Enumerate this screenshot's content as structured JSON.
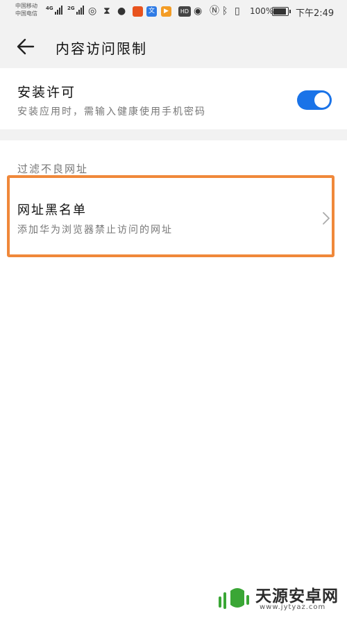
{
  "status_bar": {
    "carrier_1": "中国移动",
    "carrier_2": "中国电信",
    "network_1": "4G",
    "network_2": "2G",
    "hd_badge": "HD",
    "battery_percent": "100%",
    "battery_level": 1.0,
    "time": "下午2:49",
    "app_badge_text": "文"
  },
  "header": {
    "title": "内容访问限制"
  },
  "install_permission": {
    "title": "安装许可",
    "subtitle": "安装应用时，需输入健康使用手机密码",
    "toggle_on": true
  },
  "filter_section": {
    "label": "过滤不良网址",
    "url_blacklist": {
      "title": "网址黑名单",
      "subtitle": "添加华为浏览器禁止访问的网址"
    }
  },
  "watermark": {
    "name": "天源安卓网",
    "url": "www.jytyaz.com"
  },
  "colors": {
    "accent": "#1a73e8",
    "highlight": "#f0883a",
    "watermark_green": "#3aa635"
  }
}
